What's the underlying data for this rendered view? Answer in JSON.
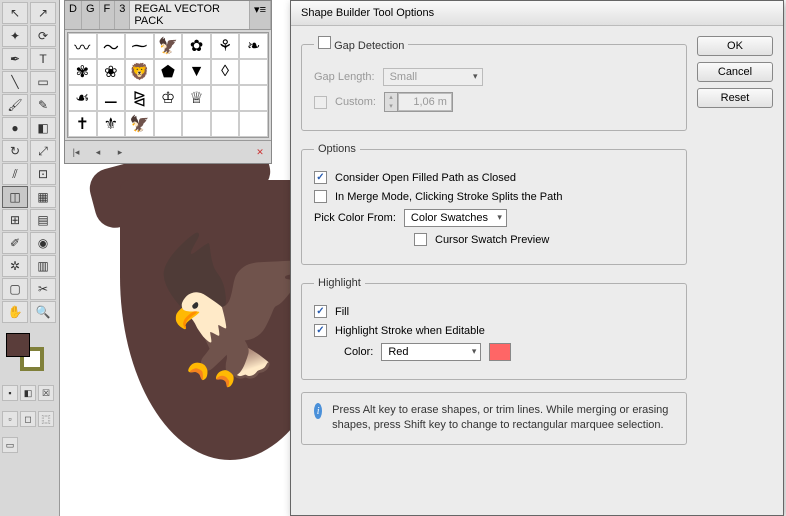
{
  "panel": {
    "tabs": [
      "D",
      "G",
      "F",
      "3"
    ],
    "activeTab": "REGAL VECTOR PACK"
  },
  "dialog": {
    "title": "Shape Builder Tool Options",
    "buttons": {
      "ok": "OK",
      "cancel": "Cancel",
      "reset": "Reset"
    },
    "gap": {
      "legend": "Gap Detection",
      "lengthLabel": "Gap Length:",
      "lengthValue": "Small",
      "customLabel": "Custom:",
      "customValue": "1,06 m"
    },
    "options": {
      "legend": "Options",
      "openPath": "Consider Open Filled Path as Closed",
      "mergeMode": "In Merge Mode, Clicking Stroke Splits the Path",
      "pickLabel": "Pick Color From:",
      "pickValue": "Color Swatches",
      "cursorPreview": "Cursor Swatch Preview"
    },
    "highlight": {
      "legend": "Highlight",
      "fill": "Fill",
      "stroke": "Highlight Stroke when Editable",
      "colorLabel": "Color:",
      "colorValue": "Red"
    },
    "info": "Press Alt key to erase shapes, or trim lines. While merging or erasing shapes, press Shift key to change to rectangular marquee selection."
  }
}
